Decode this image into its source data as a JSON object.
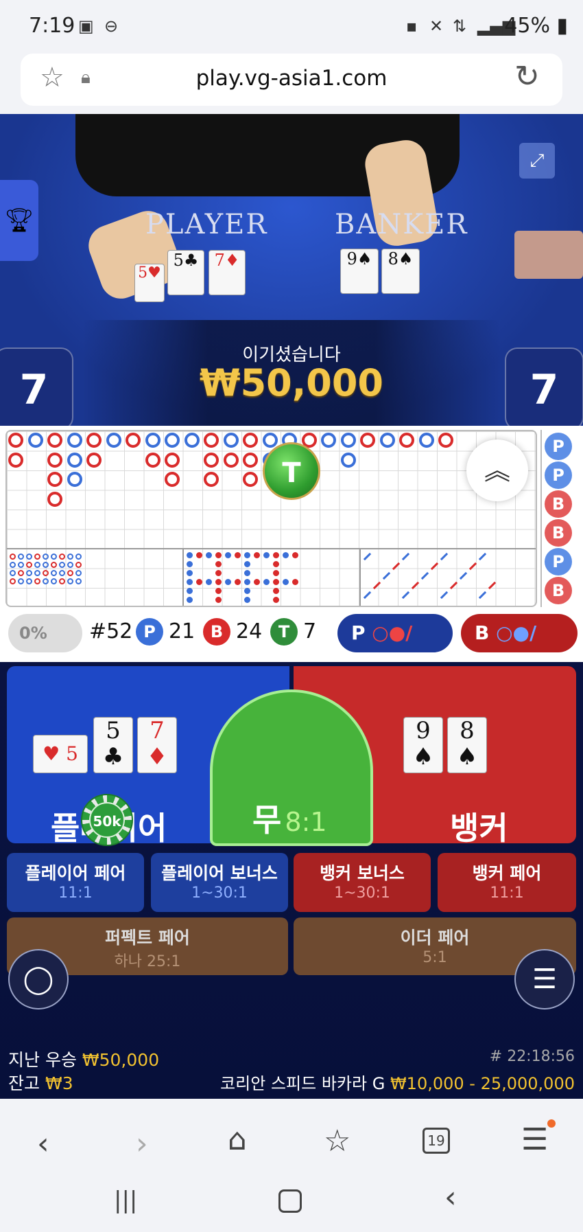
{
  "status": {
    "time": "7:19",
    "battery": "45%"
  },
  "browser": {
    "host": "play.vg-asia1.com"
  },
  "video": {
    "player_label": "PLAYER",
    "banker_label": "BANKER",
    "win_title": "이기셨습니다",
    "win_amount": "₩50,000",
    "player_score": "7",
    "banker_score": "7"
  },
  "roads": {
    "tie_label": "T",
    "side": [
      "P",
      "P",
      "B",
      "B",
      "P",
      "B"
    ]
  },
  "stats": {
    "percent": "0%",
    "round": "#52",
    "p_label": "P",
    "p_count": "21",
    "b_label": "B",
    "b_count": "24",
    "t_label": "T",
    "t_count": "7",
    "p_btn": "P",
    "b_btn": "B"
  },
  "bet": {
    "player_cards": [
      {
        "r": "5",
        "s": "♥",
        "c": "#d92b2b"
      },
      {
        "r": "5",
        "s": "♣",
        "c": "#111"
      },
      {
        "r": "7",
        "s": "♦",
        "c": "#d92b2b"
      }
    ],
    "banker_cards": [
      {
        "r": "9",
        "s": "♠",
        "c": "#111"
      },
      {
        "r": "8",
        "s": "♠",
        "c": "#111"
      }
    ],
    "player_label": "플레이어",
    "banker_label": "뱅커",
    "tie_label": "무",
    "tie_odds": "8:1",
    "chip": "50k",
    "pp": "플레이어 페어",
    "pp_odds": "11:1",
    "pb": "플레이어 보너스",
    "pb_odds": "1~30:1",
    "bb": "뱅커 보너스",
    "bb_odds": "1~30:1",
    "bp": "뱅커 페어",
    "bp_odds": "11:1",
    "perfect": "퍼펙트 페어",
    "perfect_odds": "하나 25:1",
    "either": "이더 페어",
    "either_odds": "5:1"
  },
  "footer": {
    "last_win_label": "지난 우승",
    "last_win": "₩50,000",
    "balance_label": "잔고",
    "balance": "₩3",
    "round_id": "# 22:18:56",
    "table_name": "코리안 스피드 바카라 G",
    "limits": "₩10,000 - 25,000,000"
  },
  "nav": {
    "tabs": "19"
  }
}
